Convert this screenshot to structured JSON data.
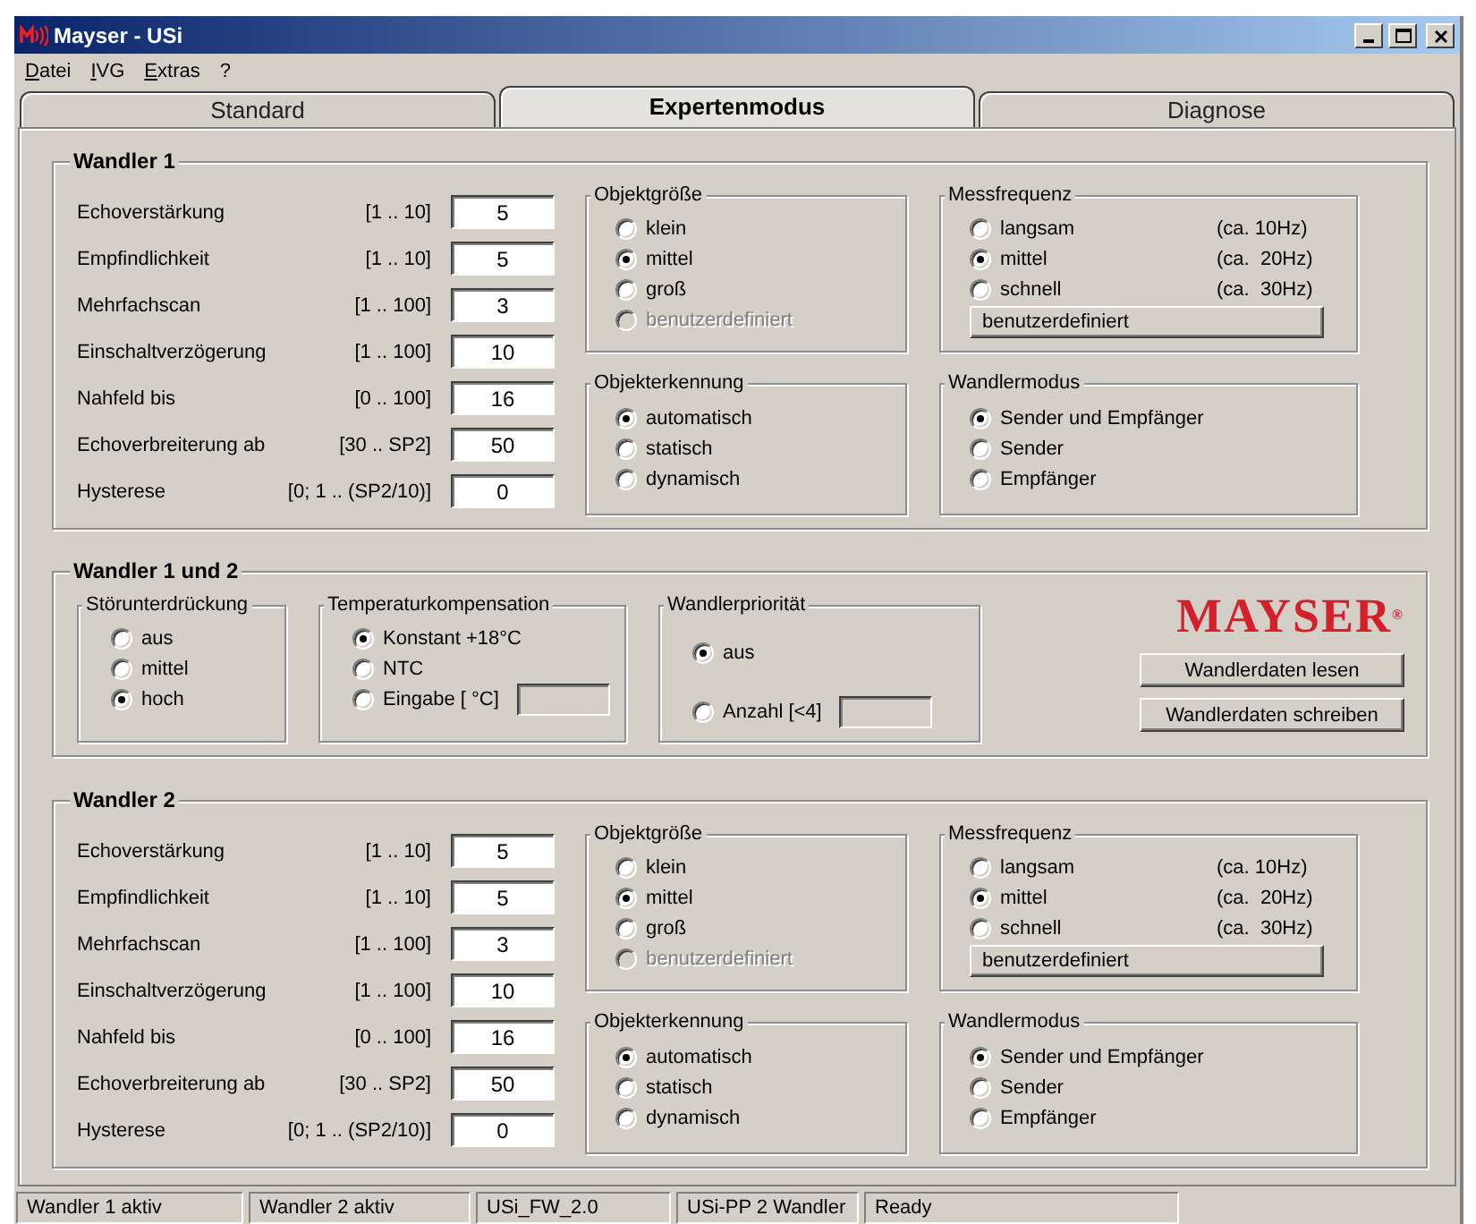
{
  "window": {
    "title": "Mayser - USi"
  },
  "menu": [
    "Datei",
    "IVG",
    "Extras",
    "?"
  ],
  "tabs": [
    {
      "label": "Standard",
      "selected": false
    },
    {
      "label": "Expertenmodus",
      "selected": true
    },
    {
      "label": "Diagnose",
      "selected": false
    }
  ],
  "wandler_groups": [
    {
      "title": "Wandler 1",
      "params": [
        {
          "label": "Echoverstärkung",
          "range": "[1 .. 10]",
          "value": "5"
        },
        {
          "label": "Empfindlichkeit",
          "range": "[1 .. 10]",
          "value": "5"
        },
        {
          "label": "Mehrfachscan",
          "range": "[1 .. 100]",
          "value": "3"
        },
        {
          "label": "Einschaltverzögerung",
          "range": "[1 .. 100]",
          "value": "10"
        },
        {
          "label": "Nahfeld bis",
          "range": "[0 .. 100]",
          "value": "16"
        },
        {
          "label": "Echoverbreiterung ab",
          "range": "[30 .. SP2]",
          "value": "50"
        },
        {
          "label": "Hysterese",
          "range": "[0; 1 .. (SP2/10)]",
          "value": "0"
        }
      ],
      "objektgroesse": {
        "title": "Objektgröße",
        "options": [
          {
            "label": "klein",
            "selected": false,
            "disabled": false
          },
          {
            "label": "mittel",
            "selected": true,
            "disabled": false
          },
          {
            "label": "groß",
            "selected": false,
            "disabled": false
          },
          {
            "label": "benutzerdefiniert",
            "selected": false,
            "disabled": true
          }
        ]
      },
      "messfrequenz": {
        "title": "Messfrequenz",
        "options": [
          {
            "label": "langsam",
            "note": "(ca. 10Hz)",
            "selected": false
          },
          {
            "label": "mittel",
            "note": "(ca.  20Hz)",
            "selected": true
          },
          {
            "label": "schnell",
            "note": "(ca.  30Hz)",
            "selected": false
          }
        ],
        "button": "benutzerdefiniert"
      },
      "objekterkennung": {
        "title": "Objekterkennung",
        "options": [
          {
            "label": "automatisch",
            "selected": true
          },
          {
            "label": "statisch",
            "selected": false
          },
          {
            "label": "dynamisch",
            "selected": false
          }
        ]
      },
      "wandlermodus": {
        "title": "Wandlermodus",
        "options": [
          {
            "label": "Sender und Empfänger",
            "selected": true
          },
          {
            "label": "Sender",
            "selected": false
          },
          {
            "label": "Empfänger",
            "selected": false
          }
        ]
      }
    },
    {
      "title": "Wandler 2",
      "params": [
        {
          "label": "Echoverstärkung",
          "range": "[1 .. 10]",
          "value": "5"
        },
        {
          "label": "Empfindlichkeit",
          "range": "[1 .. 10]",
          "value": "5"
        },
        {
          "label": "Mehrfachscan",
          "range": "[1 .. 100]",
          "value": "3"
        },
        {
          "label": "Einschaltverzögerung",
          "range": "[1 .. 100]",
          "value": "10"
        },
        {
          "label": "Nahfeld bis",
          "range": "[0 .. 100]",
          "value": "16"
        },
        {
          "label": "Echoverbreiterung ab",
          "range": "[30 .. SP2]",
          "value": "50"
        },
        {
          "label": "Hysterese",
          "range": "[0; 1 .. (SP2/10)]",
          "value": "0"
        }
      ],
      "objektgroesse": {
        "title": "Objektgröße",
        "options": [
          {
            "label": "klein",
            "selected": false,
            "disabled": false
          },
          {
            "label": "mittel",
            "selected": true,
            "disabled": false
          },
          {
            "label": "groß",
            "selected": false,
            "disabled": false
          },
          {
            "label": "benutzerdefiniert",
            "selected": false,
            "disabled": true
          }
        ]
      },
      "messfrequenz": {
        "title": "Messfrequenz",
        "options": [
          {
            "label": "langsam",
            "note": "(ca. 10Hz)",
            "selected": false
          },
          {
            "label": "mittel",
            "note": "(ca.  20Hz)",
            "selected": true
          },
          {
            "label": "schnell",
            "note": "(ca.  30Hz)",
            "selected": false
          }
        ],
        "button": "benutzerdefiniert"
      },
      "objekterkennung": {
        "title": "Objekterkennung",
        "options": [
          {
            "label": "automatisch",
            "selected": true
          },
          {
            "label": "statisch",
            "selected": false
          },
          {
            "label": "dynamisch",
            "selected": false
          }
        ]
      },
      "wandlermodus": {
        "title": "Wandlermodus",
        "options": [
          {
            "label": "Sender und Empfänger",
            "selected": true
          },
          {
            "label": "Sender",
            "selected": false
          },
          {
            "label": "Empfänger",
            "selected": false
          }
        ]
      }
    }
  ],
  "wandler_1_und_2": {
    "title": "Wandler 1 und 2",
    "stoerunterdrueckung": {
      "title": "Störunterdrückung",
      "options": [
        {
          "label": "aus",
          "selected": false,
          "kind": "plain"
        },
        {
          "label": "mittel",
          "selected": false,
          "kind": "plain"
        },
        {
          "label": "hoch",
          "selected": true,
          "kind": "plain"
        }
      ]
    },
    "temperaturkompensation": {
      "title": "Temperaturkompensation",
      "options": [
        {
          "label": "Konstant +18°C",
          "selected": true,
          "kind": "plain"
        },
        {
          "label": "NTC",
          "selected": false,
          "kind": "plain"
        },
        {
          "label": "Eingabe [ °C]",
          "selected": false,
          "kind": "field"
        }
      ]
    },
    "wandlerprioritaet": {
      "title": "Wandlerpriorität",
      "options": [
        {
          "label": "aus",
          "selected": true,
          "kind": "plain"
        },
        {
          "label": "Anzahl [<4]",
          "selected": false,
          "kind": "field"
        }
      ]
    },
    "logo": "MAYSER$^{®}$",
    "buttons": [
      "Wandlerdaten lesen",
      "Wandlerdaten schreiben"
    ]
  },
  "status_bar": [
    "Wandler 1 aktiv",
    "Wandler 2 aktiv",
    "USi_FW_2.0",
    "USi-PP 2 Wandler",
    "Ready"
  ]
}
